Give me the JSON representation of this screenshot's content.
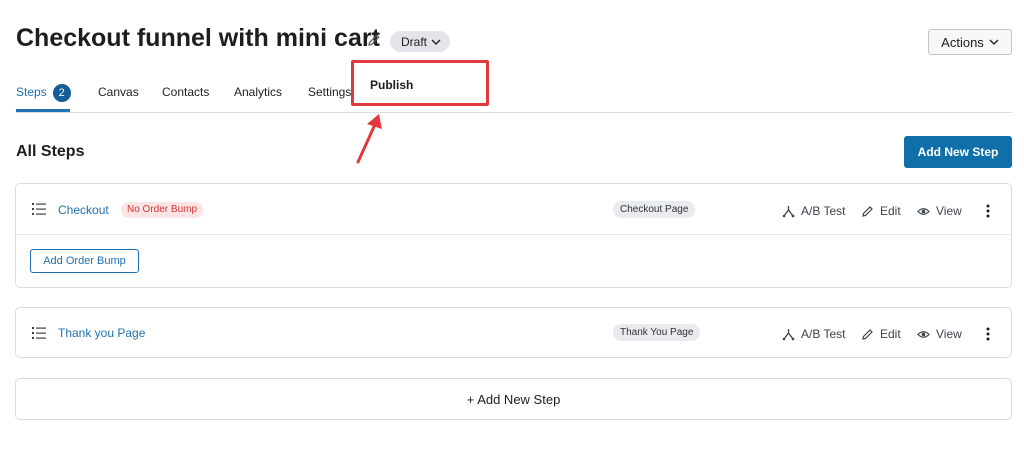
{
  "header": {
    "title": "Checkout funnel with mini cart",
    "status": "Draft",
    "actions_label": "Actions"
  },
  "status_menu": {
    "items": [
      "Publish"
    ]
  },
  "tabs": [
    {
      "label": "Steps",
      "badge": "2",
      "active": true
    },
    {
      "label": "Canvas"
    },
    {
      "label": "Contacts"
    },
    {
      "label": "Analytics"
    },
    {
      "label": "Settings"
    }
  ],
  "section": {
    "title": "All Steps",
    "add_step_label": "Add New Step"
  },
  "steps": [
    {
      "name": "Checkout",
      "badge": "No Order Bump",
      "type": "Checkout Page",
      "actions": {
        "ab_test": "A/B Test",
        "edit": "Edit",
        "view": "View"
      },
      "add_bump_label": "Add Order Bump"
    },
    {
      "name": "Thank you Page",
      "type": "Thank You Page",
      "actions": {
        "ab_test": "A/B Test",
        "edit": "Edit",
        "view": "View"
      }
    }
  ],
  "footer": {
    "add_step_label": "+ Add New Step"
  },
  "colors": {
    "accent": "#2271b1",
    "primary_button": "#0f6fa8",
    "highlight": "#e0393e",
    "danger_badge": "#d63638"
  }
}
